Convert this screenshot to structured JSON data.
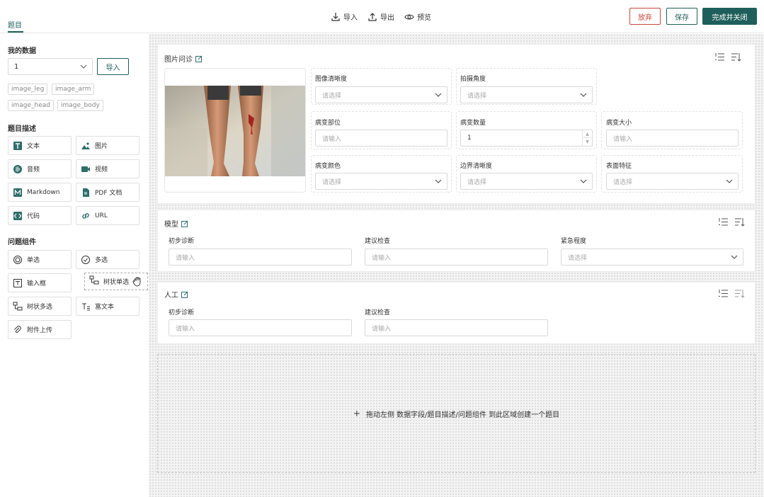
{
  "header": {
    "tab": "题目",
    "actions": {
      "import": "导入",
      "export": "导出",
      "preview": "预览"
    },
    "buttons": {
      "discard": "放弃",
      "save": "保存",
      "finish": "完成并关闭"
    }
  },
  "sidebar": {
    "my_data": {
      "title": "我的数据",
      "select_value": "1",
      "import_label": "导入",
      "tags": [
        "image_leg",
        "image_arm",
        "image_head",
        "image_body"
      ]
    },
    "desc": {
      "title": "题目描述",
      "items": [
        {
          "label": "文本",
          "icon": "text-icon"
        },
        {
          "label": "图片",
          "icon": "image-icon"
        },
        {
          "label": "音频",
          "icon": "audio-icon"
        },
        {
          "label": "视频",
          "icon": "video-icon"
        },
        {
          "label": "Markdown",
          "icon": "markdown-icon"
        },
        {
          "label": "PDF 文档",
          "icon": "pdf-icon"
        },
        {
          "label": "代码",
          "icon": "code-icon"
        },
        {
          "label": "URL",
          "icon": "link-icon"
        }
      ]
    },
    "components": {
      "title": "问题组件",
      "items": [
        {
          "label": "单选",
          "icon": "radio-icon"
        },
        {
          "label": "多选",
          "icon": "checkbox-icon"
        },
        {
          "label": "输入框",
          "icon": "input-icon"
        },
        {
          "label": "树状多选",
          "icon": "tree-icon"
        },
        {
          "label": "富文本",
          "icon": "rich-text-icon"
        },
        {
          "label": "附件上传",
          "icon": "attachment-icon"
        }
      ],
      "drag_label": "树状单选"
    }
  },
  "canvas": {
    "card1": {
      "title": "图片问诊",
      "fields": {
        "clarity": {
          "label": "图像清晰度",
          "placeholder": "请选择"
        },
        "angle": {
          "label": "拍摄角度",
          "placeholder": "请选择"
        },
        "location": {
          "label": "病变部位",
          "placeholder": "请输入"
        },
        "count": {
          "label": "病变数量",
          "value": "1"
        },
        "size": {
          "label": "病变大小",
          "placeholder": "请输入"
        },
        "color": {
          "label": "病变颜色",
          "placeholder": "请选择"
        },
        "edge": {
          "label": "边界清晰度",
          "placeholder": "请选择"
        },
        "surface": {
          "label": "表面特征",
          "placeholder": "请选择"
        }
      }
    },
    "card2": {
      "title": "模型",
      "fields": {
        "diagnosis": {
          "label": "初步诊断",
          "placeholder": "请输入"
        },
        "exam": {
          "label": "建议检查",
          "placeholder": "请输入"
        },
        "urgency": {
          "label": "紧急程度",
          "placeholder": "请选择"
        }
      }
    },
    "card3": {
      "title": "人工",
      "fields": {
        "diagnosis": {
          "label": "初步诊断",
          "placeholder": "请输入"
        },
        "exam": {
          "label": "建议检查",
          "placeholder": "请输入"
        }
      }
    },
    "dropzone": {
      "plus": "+",
      "text": "拖动左侧 数据字段/题目描述/问题组件 到此区域创建一个题目"
    }
  },
  "colors": {
    "primary": "#1f5f5b",
    "danger": "#c9463d"
  }
}
